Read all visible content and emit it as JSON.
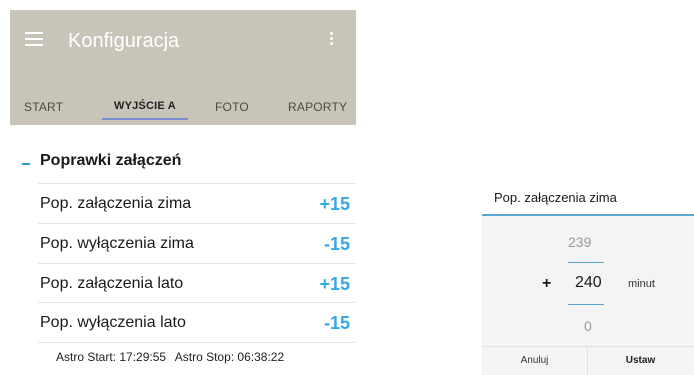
{
  "appbar": {
    "title": "Konfiguracja",
    "menu_icon": "hamburger-menu-icon",
    "more_icon": "more-vert-icon",
    "color": "#c8c4b8"
  },
  "tabs": [
    {
      "label": "START",
      "active": false
    },
    {
      "label": "WYJŚCIE A",
      "active": true
    },
    {
      "label": "FOTO",
      "active": false
    },
    {
      "label": "RAPORTY",
      "active": false
    }
  ],
  "section": {
    "collapse_symbol": "-",
    "title": "Poprawki załączeń",
    "rows": [
      {
        "label": "Pop. załączenia zima",
        "value": "+15"
      },
      {
        "label": "Pop. wyłączenia zima",
        "value": "-15"
      },
      {
        "label": "Pop. załączenia lato",
        "value": "+15"
      },
      {
        "label": "Pop. wyłączenia lato",
        "value": "-15"
      }
    ],
    "value_color": "#33a9e0"
  },
  "astro": {
    "start": "Astro Start: 17:29:55",
    "stop": "Astro Stop: 06:38:22"
  },
  "dialog": {
    "title": "Pop. załączenia zima",
    "prev_value": "239",
    "sign": "+",
    "current_value": "240",
    "unit": "minut",
    "next_value": "0",
    "cancel_label": "Anuluj",
    "ok_label": "Ustaw",
    "accent": "#5aa6cf"
  }
}
